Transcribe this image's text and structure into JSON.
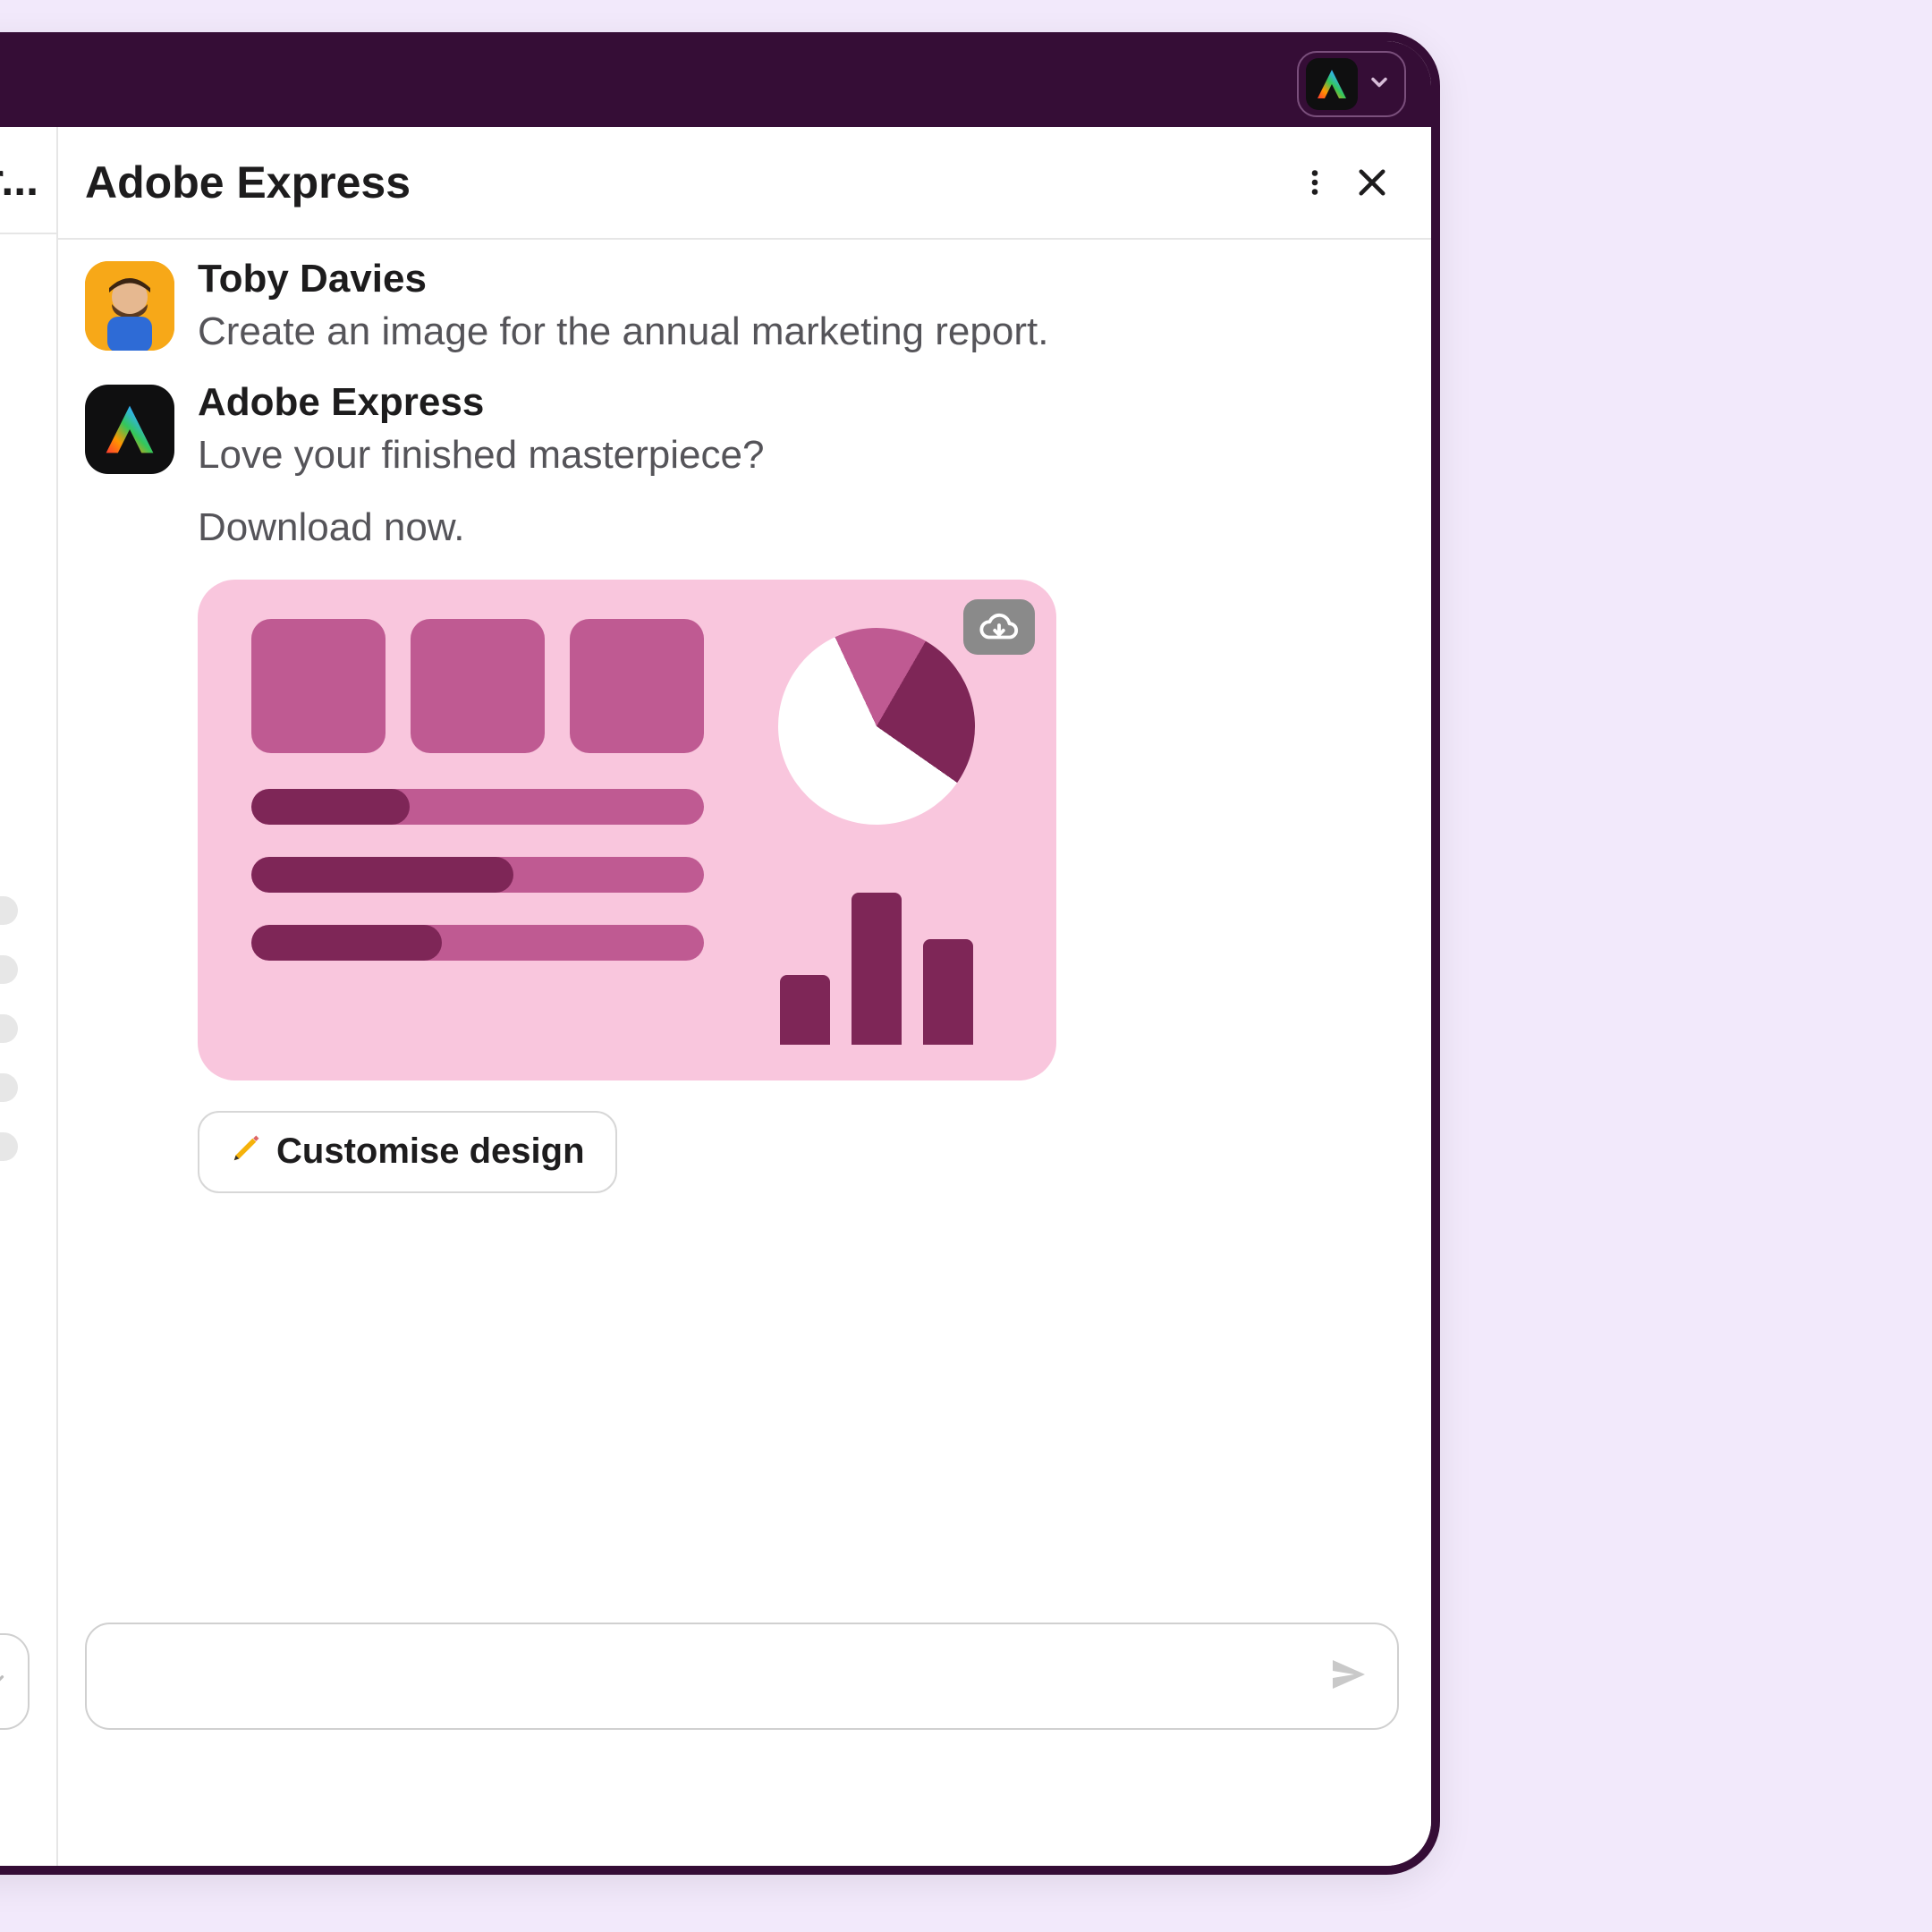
{
  "titlebar": {
    "extension_name": "Adobe Express"
  },
  "channel": {
    "truncated_name": "tive-r..."
  },
  "panel": {
    "title": "Adobe Express"
  },
  "messages": [
    {
      "sender": "Toby Davies",
      "text": "Create an image for the annual marketing report."
    },
    {
      "sender": "Adobe Express",
      "line1": "Love your finished masterpiece?",
      "line2": "Download now.",
      "button_label": "Customise design",
      "button_emoji": "✏️"
    }
  ],
  "composer": {
    "placeholder": ""
  }
}
